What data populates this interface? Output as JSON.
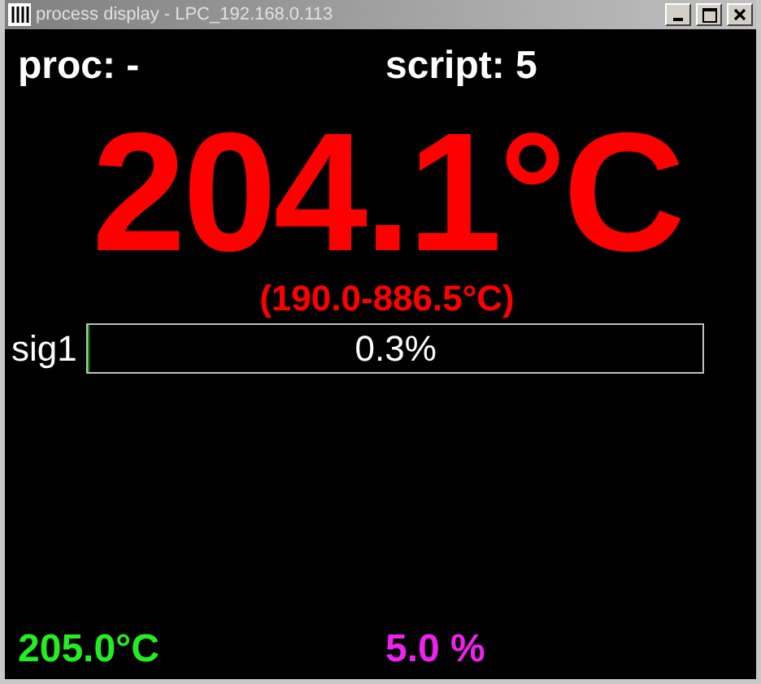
{
  "window": {
    "title": "process display - LPC_192.168.0.113"
  },
  "header": {
    "proc": "proc: -",
    "script": "script: 5"
  },
  "temperature": {
    "value": "204.1°C",
    "range": "(190.0-886.5°C)"
  },
  "signals": [
    {
      "name": "sig1",
      "level": 0.003,
      "reading": "0.3%"
    }
  ],
  "footer": [
    {
      "text": "205.0°C",
      "color": "#22ee22"
    },
    {
      "text": "5.0 %",
      "color": "#ee22ee"
    }
  ]
}
